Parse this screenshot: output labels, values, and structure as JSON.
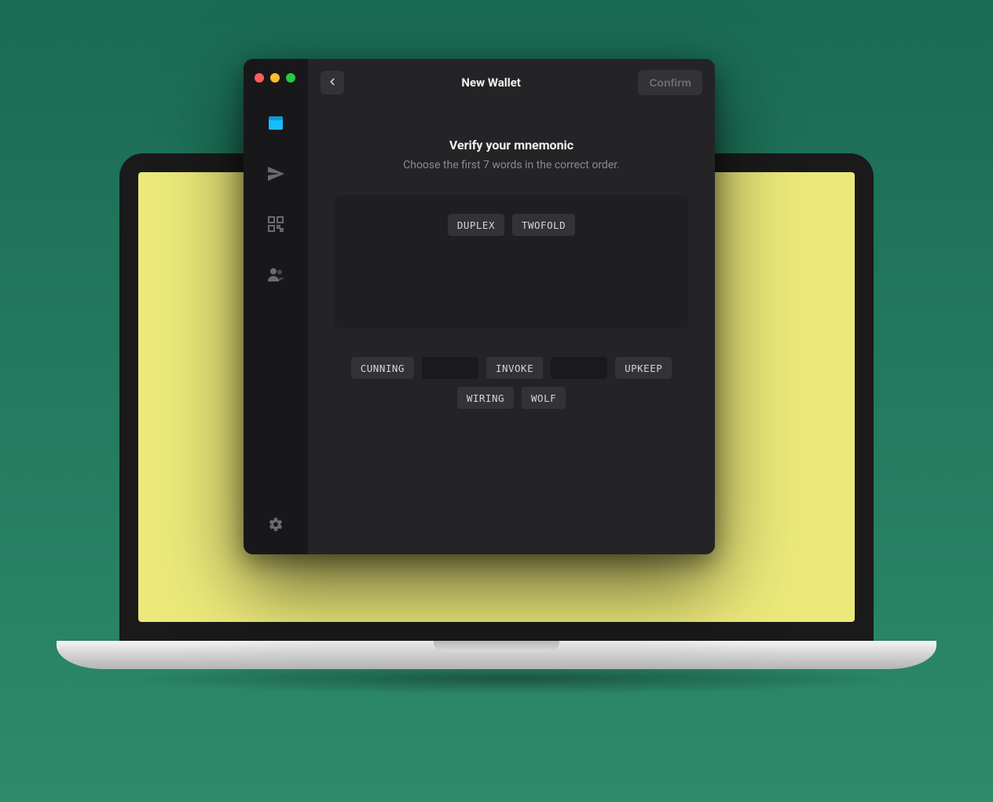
{
  "header": {
    "title": "New Wallet",
    "confirm_label": "Confirm"
  },
  "verify": {
    "title": "Verify your mnemonic",
    "subtitle": "Choose the first 7 words in the correct order."
  },
  "selected_words": [
    {
      "text": "DUPLEX",
      "empty": false
    },
    {
      "text": "TWOFOLD",
      "empty": false
    }
  ],
  "pool_words": [
    {
      "text": "CUNNING",
      "empty": false
    },
    {
      "text": "",
      "empty": true
    },
    {
      "text": "INVOKE",
      "empty": false
    },
    {
      "text": "",
      "empty": true
    },
    {
      "text": "UPKEEP",
      "empty": false
    },
    {
      "text": "WIRING",
      "empty": false
    },
    {
      "text": "WOLF",
      "empty": false
    }
  ],
  "sidebar": {
    "items": [
      {
        "name": "wallet",
        "active": true
      },
      {
        "name": "send",
        "active": false
      },
      {
        "name": "receive",
        "active": false
      },
      {
        "name": "contacts",
        "active": false
      }
    ]
  }
}
